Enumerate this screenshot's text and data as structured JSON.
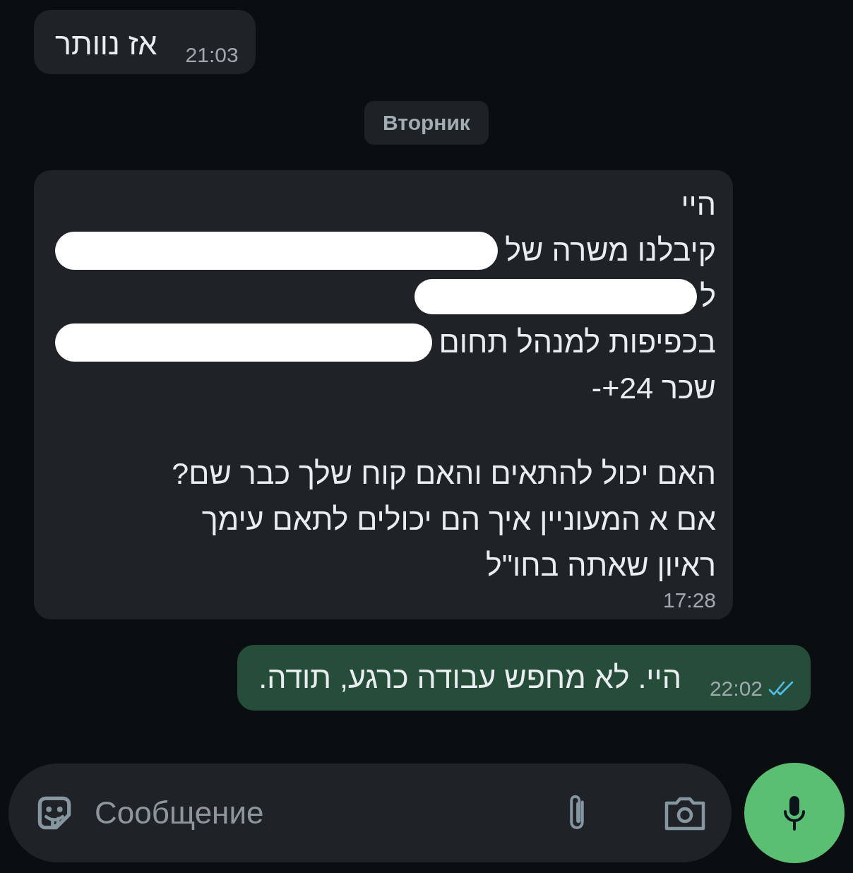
{
  "messages": [
    {
      "kind": "incoming",
      "paragraphs": [
        [
          {
            "text": "אז נוותר",
            "redacted": false
          }
        ]
      ],
      "time": "21:03"
    },
    {
      "kind": "date",
      "text": "Вторник"
    },
    {
      "kind": "incoming",
      "paragraphs": [
        [
          {
            "text": "היי",
            "redacted": false
          },
          {
            "text": "קיבלנו משרה של",
            "redacted": true
          },
          {
            "text": "ל",
            "redacted": true
          },
          {
            "text": "בכפיפות למנהל תחום",
            "redacted": true
          },
          {
            "text": "שכר 24+-",
            "redacted": false
          }
        ],
        [
          {
            "text": "האם יכול להתאים והאם קוח שלך כבר שם?",
            "redacted": false
          },
          {
            "text": "אם א המעוניין איך הם יכולים לתאם עימך",
            "redacted": false
          },
          {
            "text": "ראיון שאתה בחו\"ל",
            "redacted": false
          }
        ]
      ],
      "time": "17:28"
    },
    {
      "kind": "outgoing",
      "paragraphs": [
        [
          {
            "text": "היי. לא מחפש עבודה כרגע, תודה.",
            "redacted": false
          }
        ]
      ],
      "time": "22:02",
      "read": true
    }
  ],
  "composer": {
    "placeholder": "Сообщение"
  }
}
